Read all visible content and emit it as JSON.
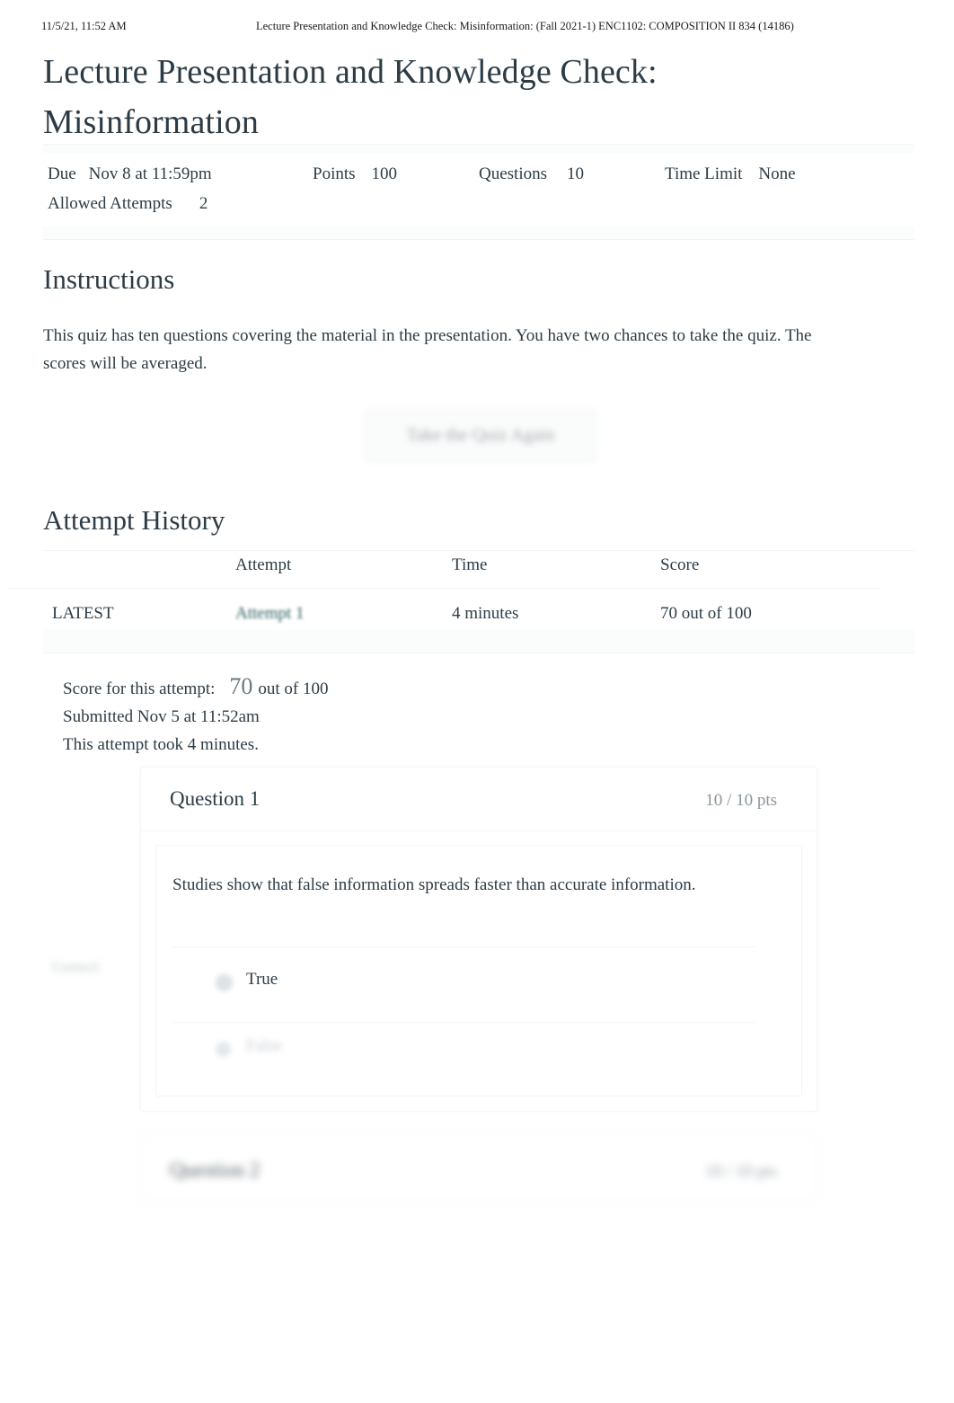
{
  "print_header": {
    "datetime": "11/5/21, 11:52 AM",
    "title": "Lecture Presentation and Knowledge Check: Misinformation: (Fall 2021-1) ENC1102: COMPOSITION II 834 (14186)"
  },
  "quiz": {
    "title": "Lecture Presentation and Knowledge Check: Misinformation",
    "meta": {
      "due_label": "Due",
      "due_value": "Nov 8 at 11:59pm",
      "points_label": "Points",
      "points_value": "100",
      "questions_label": "Questions",
      "questions_value": "10",
      "time_limit_label": "Time Limit",
      "time_limit_value": "None",
      "allowed_attempts_label": "Allowed Attempts",
      "allowed_attempts_value": "2"
    }
  },
  "instructions": {
    "heading": "Instructions",
    "body": "This quiz has ten questions covering the material in the presentation. You have two chances to take the quiz. The scores will be averaged."
  },
  "actions": {
    "take_quiz_again": "Take the Quiz Again"
  },
  "attempt_history": {
    "heading": "Attempt History",
    "columns": {
      "flag": "",
      "attempt": "Attempt",
      "time": "Time",
      "score": "Score"
    },
    "rows": [
      {
        "flag": "LATEST",
        "attempt": "Attempt 1",
        "time": "4 minutes",
        "score": "70 out of 100"
      }
    ]
  },
  "score_summary": {
    "score_label": "Score for this attempt:",
    "score_value": "70",
    "score_suffix": "out of 100",
    "submitted": "Submitted Nov 5 at 11:52am",
    "duration": "This attempt took 4 minutes."
  },
  "questions": [
    {
      "title": "Question 1",
      "points": "10 / 10 pts",
      "text": "Studies show that false information spreads faster than accurate information.",
      "correct_flag": "Correct!",
      "answers": [
        {
          "label": "True",
          "selected": true
        },
        {
          "label": "False",
          "selected": false
        }
      ]
    },
    {
      "title": "Question 2",
      "points": "10 / 10 pts"
    }
  ],
  "colors": {
    "text": "#2d3b45",
    "link_teal": "#2d5f5d",
    "muted": "#8b959c",
    "rule": "#f2f4f5"
  }
}
